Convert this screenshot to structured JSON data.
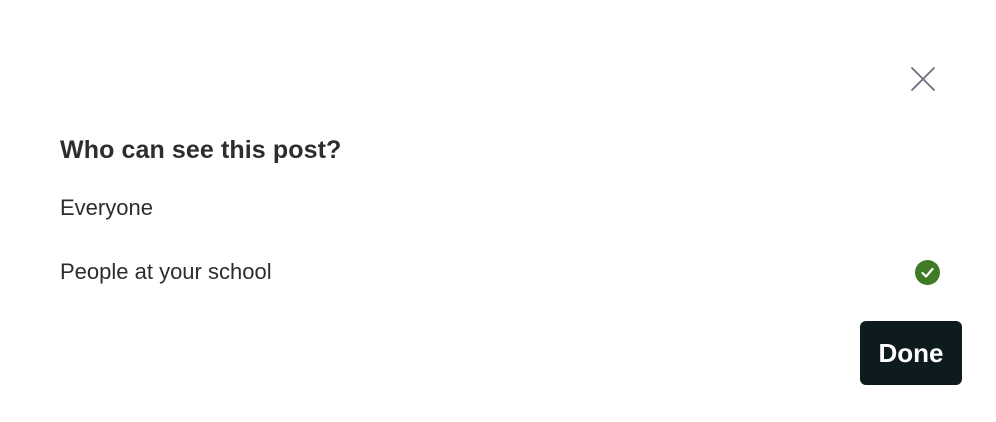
{
  "dialog": {
    "title": "Who can see this post?",
    "options": [
      {
        "label": "Everyone",
        "selected": false
      },
      {
        "label": "People at your school",
        "selected": true
      }
    ],
    "done_label": "Done",
    "close_icon": "close-icon",
    "check_icon": "check-circle-icon"
  },
  "colors": {
    "check_green": "#3f7a24",
    "done_bg": "#0d1b1e",
    "text": "#2d2d2d",
    "close_icon": "#6b6f80"
  }
}
